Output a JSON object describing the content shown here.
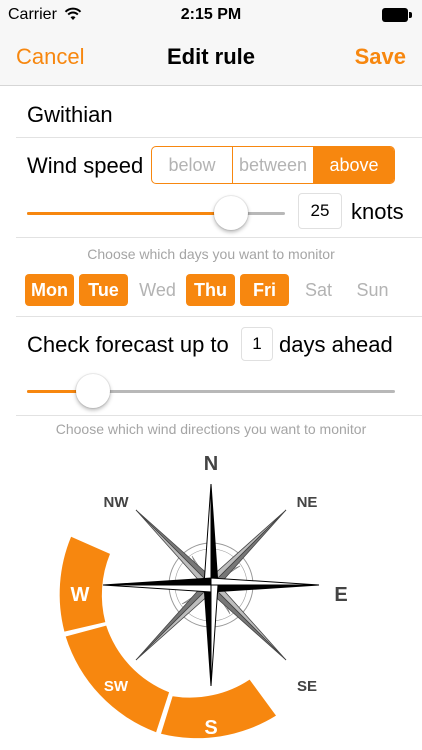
{
  "status": {
    "carrier": "Carrier",
    "time": "2:15 PM"
  },
  "nav": {
    "cancel_label": "Cancel",
    "title": "Edit rule",
    "save_label": "Save"
  },
  "rule": {
    "name": "Gwithian"
  },
  "wind_speed": {
    "label": "Wind speed",
    "modes": [
      "below",
      "between",
      "above"
    ],
    "selected_mode": "above",
    "value": "25",
    "unit": "knots",
    "slider_fraction": 0.79
  },
  "days": {
    "hint": "Choose which days you want to monitor",
    "items": [
      {
        "label": "Mon",
        "selected": true
      },
      {
        "label": "Tue",
        "selected": true
      },
      {
        "label": "Wed",
        "selected": false
      },
      {
        "label": "Thu",
        "selected": true
      },
      {
        "label": "Fri",
        "selected": true
      },
      {
        "label": "Sat",
        "selected": false
      },
      {
        "label": "Sun",
        "selected": false
      }
    ]
  },
  "forecast": {
    "prefix": "Check forecast up to",
    "value": "1",
    "suffix": "days ahead",
    "slider_fraction": 0.18
  },
  "directions": {
    "hint": "Choose which wind directions you want to monitor",
    "labels": {
      "n": "N",
      "ne": "NE",
      "e": "E",
      "se": "SE",
      "s": "S",
      "sw": "SW",
      "w": "W",
      "nw": "NW"
    },
    "selected": [
      "S",
      "SW",
      "W"
    ]
  },
  "colors": {
    "accent": "#f7870f",
    "inactive_text": "#b3b3b3"
  },
  "icons": [
    "wifi-icon",
    "battery-icon",
    "compass-rose-icon"
  ]
}
